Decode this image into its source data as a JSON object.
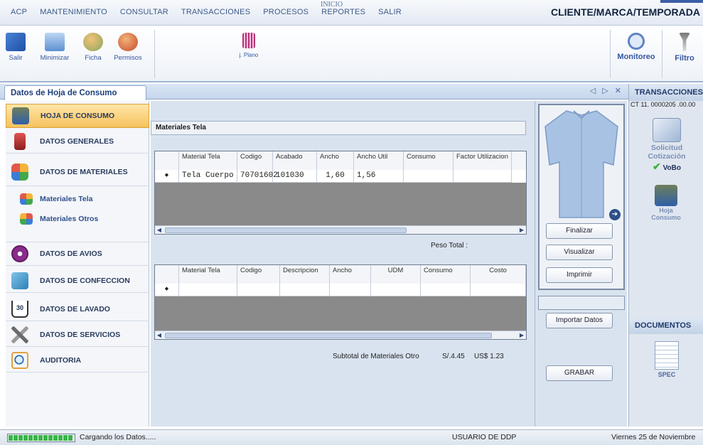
{
  "menu": [
    "ACP",
    "MANTENIMIENTO",
    "CONSULTAR",
    "TRANSACCIONES",
    "PROCESOS",
    "REPORTES",
    "SALIR"
  ],
  "inicio_label": "INICIO",
  "context_title": "CLIENTE/MARCA/TEMPORADA",
  "toolbar": {
    "salir": "Salir",
    "minimizar": "Minimizar",
    "ficha": "Ficha",
    "permisos": "Permisos",
    "plano": "j. Plano",
    "monitoreo": "Monitoreo",
    "filtro": "Filtro"
  },
  "tab": {
    "title": "Datos de Hoja de Consumo",
    "controls": "◁ ▷ ✕"
  },
  "nav": {
    "hoja_consumo": "HOJA DE CONSUMO",
    "datos_generales": "DATOS GENERALES",
    "datos_materiales": "DATOS DE MATERIALES",
    "materiales_tela": "Materiales Tela",
    "materiales_otros": "Materiales Otros",
    "datos_avios": "DATOS DE AVIOS",
    "datos_confeccion": "DATOS DE CONFECCION",
    "datos_lavado": "DATOS DE LAVADO",
    "datos_servicios": "DATOS DE SERVICIOS",
    "auditoria": "AUDITORIA",
    "lavado_badge": "30"
  },
  "tela_grid": {
    "section_title": "Materiales Tela",
    "columns": [
      "Material Tela",
      "Codigo",
      "Acabado",
      "Ancho",
      "Ancho Util",
      "Consumo",
      "Factor Utilizacion"
    ],
    "row_marker": "◆",
    "rows": [
      [
        "Tela Cuerpo",
        "70701602",
        "101030",
        "1,60",
        "1,56",
        "",
        ""
      ]
    ]
  },
  "peso_total_label": "Peso Total :",
  "otros_grid": {
    "columns": [
      "Material Tela",
      "Codigo",
      "Descripcion",
      "Ancho",
      "UDM",
      "Consumo",
      "Costo"
    ],
    "row_marker": "◆"
  },
  "subtotal": {
    "label": "Subtotal de Materiales Otro",
    "soles": "S/.4.45",
    "dolares": "US$ 1.23"
  },
  "actions": {
    "finalizar": "Finalizar",
    "visualizar": "Visualizar",
    "imprimir": "Imprimir",
    "importar": "Importar Datos",
    "grabar": "GRABAR"
  },
  "right_panel": {
    "transacciones_header": "TRANSACCIONES",
    "doc_ref": "CT 11. 0000205 .00.00",
    "solicitud": "Solicitud",
    "cotizacion": "Cotización",
    "vobo": "VoBo",
    "hoja": "Hoja",
    "consumo": "Consumo",
    "documentos_header": "DOCUMENTOS",
    "spec": "SPEC"
  },
  "status": {
    "loading": "Cargando los Datos.....",
    "usuario": "USUARIO DE  DDP",
    "fecha": "Viernes 25 de Noviembre"
  },
  "colors": {
    "active_nav": "#f6c25d",
    "progress": "#3ab54a",
    "accent_blue": "#3557a0"
  }
}
